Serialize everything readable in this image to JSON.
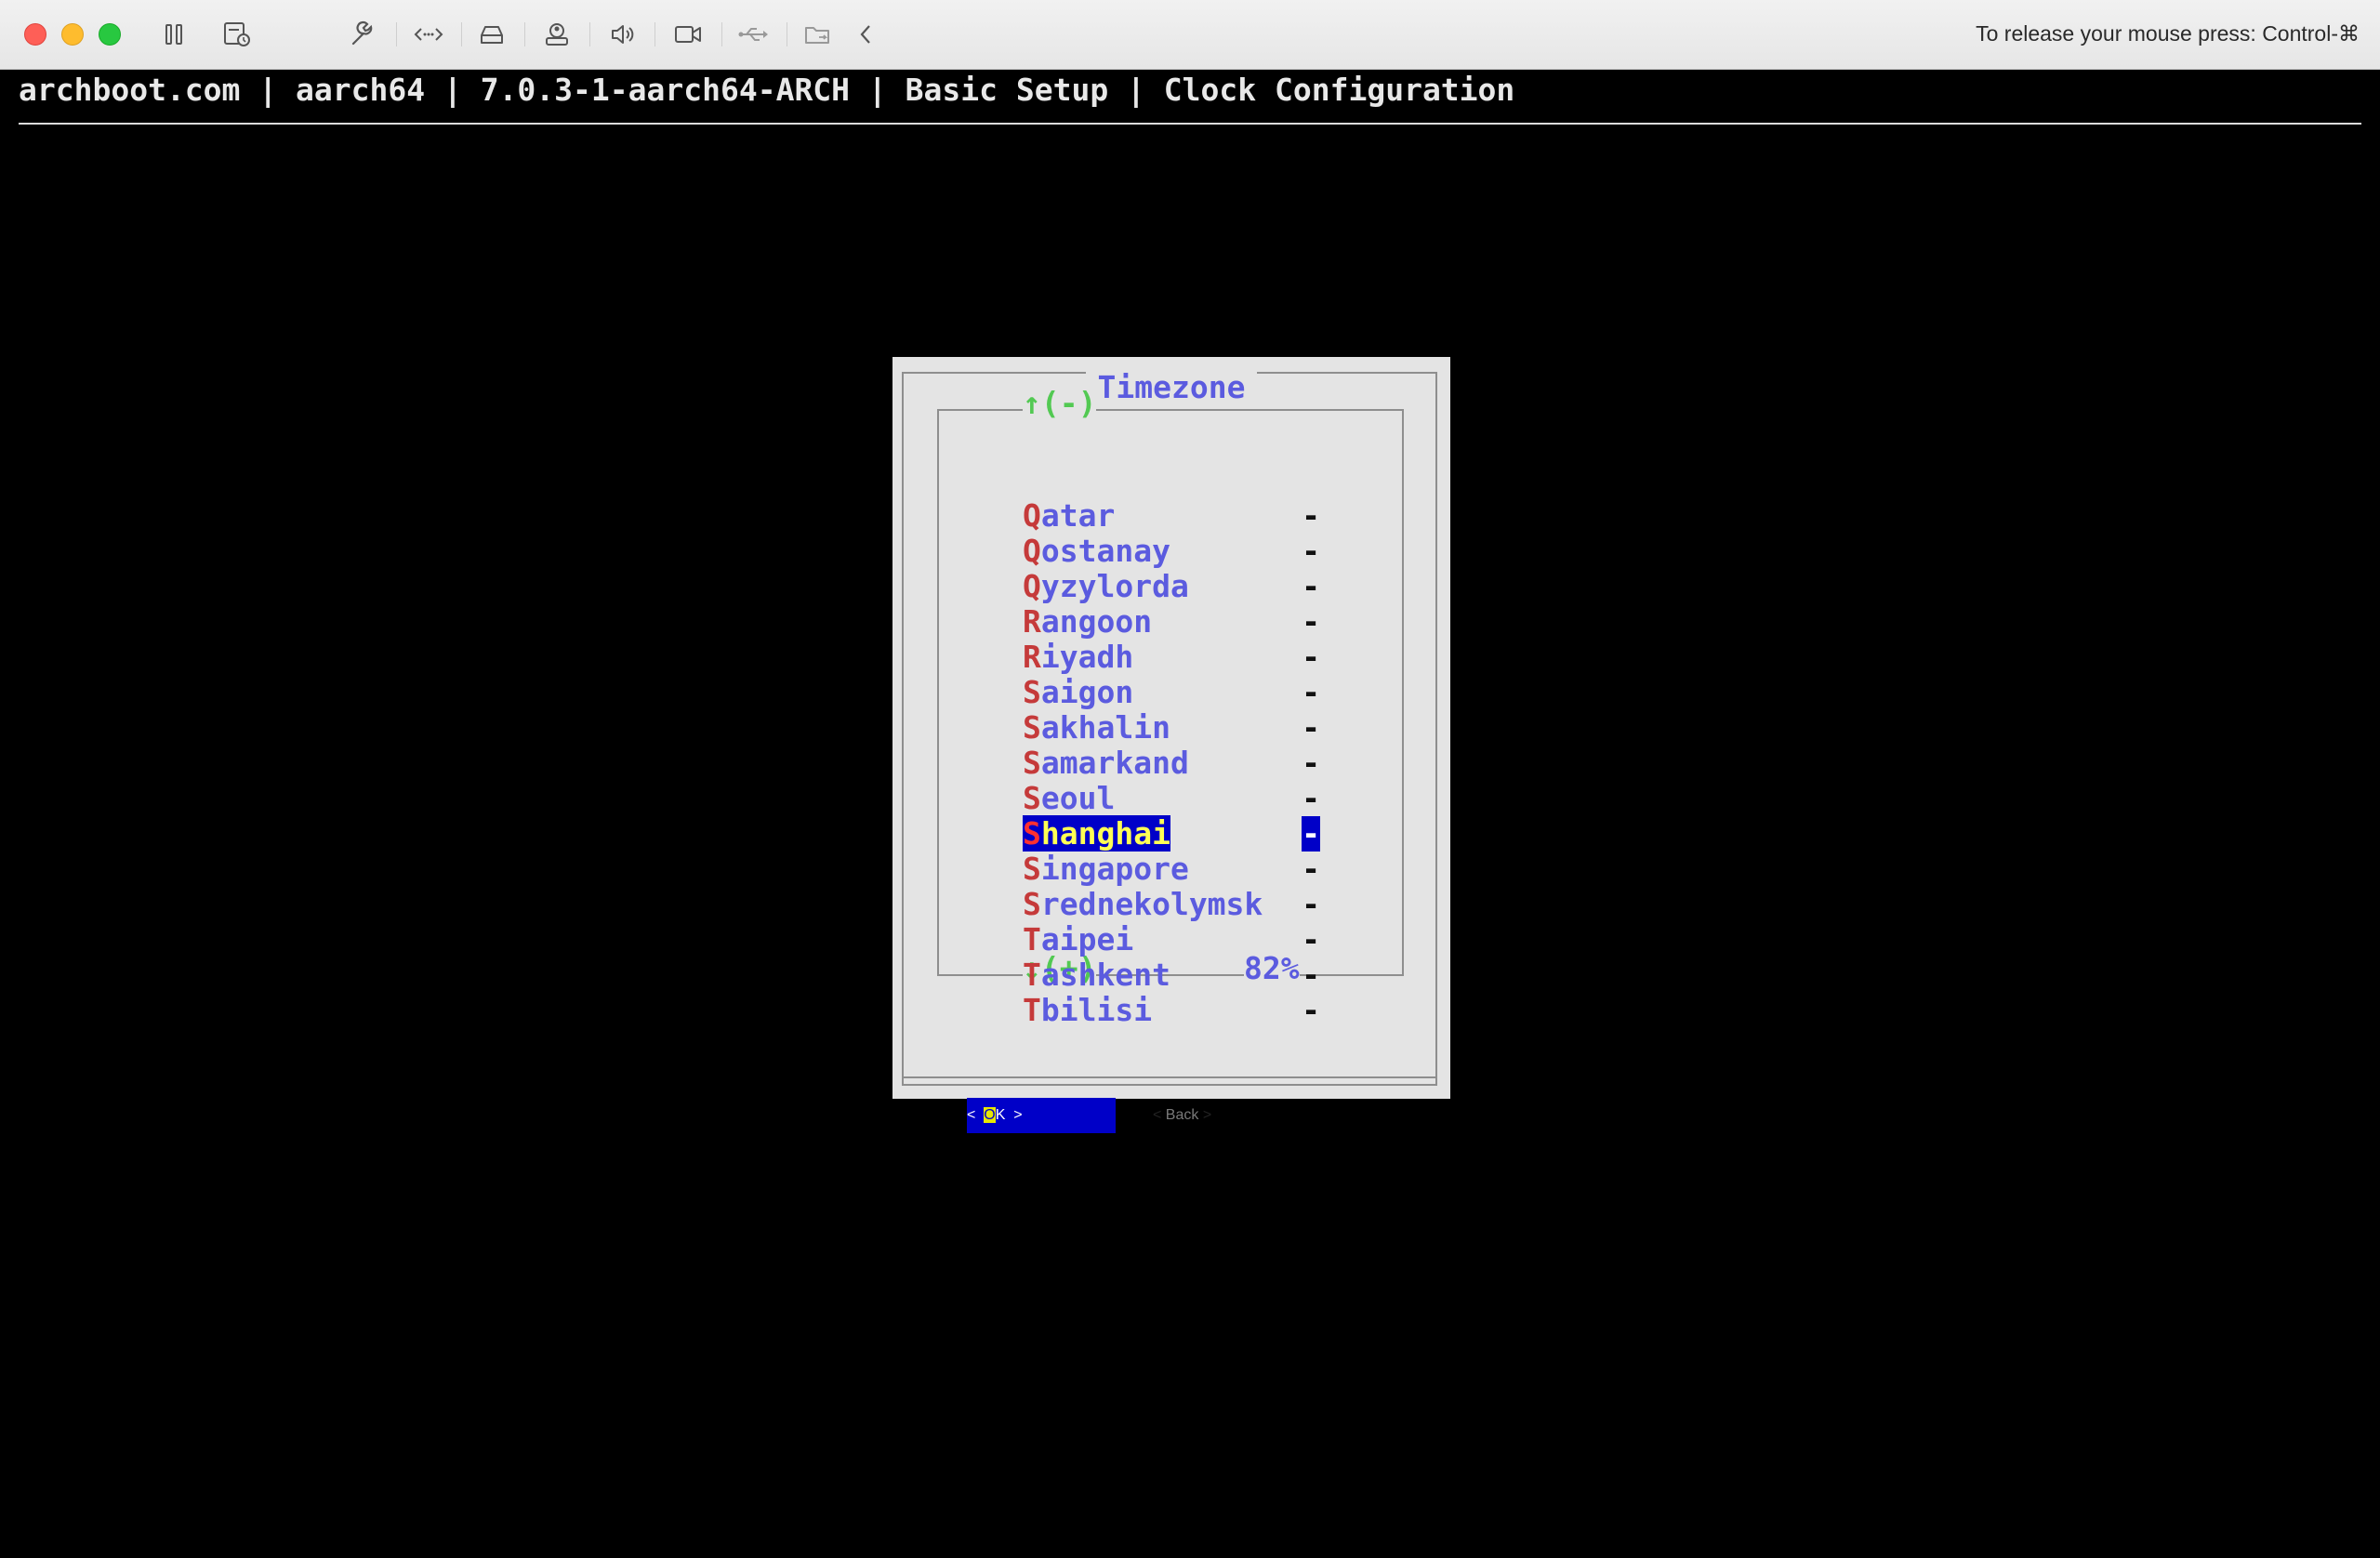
{
  "window": {
    "release_hint": "To release your mouse press: Control-⌘"
  },
  "terminal": {
    "header": "archboot.com | aarch64 | 7.0.3-1-aarch64-ARCH | Basic Setup | Clock Configuration"
  },
  "dialog": {
    "title": "Timezone",
    "scroll_up": "↑(-)",
    "scroll_down": "↓(+)",
    "scroll_percent": "82%",
    "selected_value": "Shanghai",
    "items": [
      {
        "first": "Q",
        "rest": "atar",
        "tag": "-"
      },
      {
        "first": "Q",
        "rest": "ostanay",
        "tag": "-"
      },
      {
        "first": "Q",
        "rest": "yzylorda",
        "tag": "-"
      },
      {
        "first": "R",
        "rest": "angoon",
        "tag": "-"
      },
      {
        "first": "R",
        "rest": "iyadh",
        "tag": "-"
      },
      {
        "first": "S",
        "rest": "aigon",
        "tag": "-"
      },
      {
        "first": "S",
        "rest": "akhalin",
        "tag": "-"
      },
      {
        "first": "S",
        "rest": "amarkand",
        "tag": "-"
      },
      {
        "first": "S",
        "rest": "eoul",
        "tag": "-"
      },
      {
        "first": "S",
        "rest": "hanghai",
        "tag": "-",
        "selected": true
      },
      {
        "first": "S",
        "rest": "ingapore",
        "tag": "-"
      },
      {
        "first": "S",
        "rest": "rednekolymsk",
        "tag": "-"
      },
      {
        "first": "T",
        "rest": "aipei",
        "tag": "-"
      },
      {
        "first": "T",
        "rest": "ashkent",
        "tag": "-"
      },
      {
        "first": "T",
        "rest": "bilisi",
        "tag": "-"
      }
    ],
    "buttons": {
      "ok_left": "<  ",
      "ok_hot": "O",
      "ok_rest": "K  >",
      "back_left": "< ",
      "back_label": "Back",
      "back_right": " >"
    }
  },
  "colors": {
    "list_text": "#5b5bdf",
    "hotkey": "#c53a3a",
    "selection_bg": "#0000c8",
    "scroll_indicator": "#52c952"
  }
}
